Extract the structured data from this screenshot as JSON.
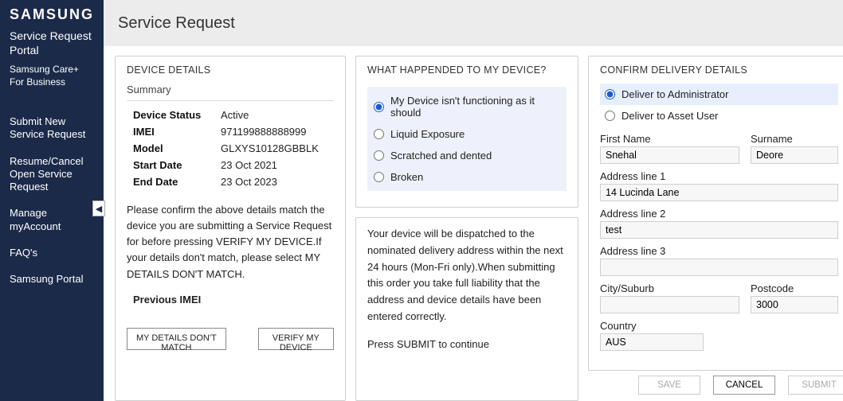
{
  "brand": {
    "name": "SAMSUNG",
    "sub1": "Service Request Portal",
    "sub2": "Samsung Care+ For Business"
  },
  "nav": {
    "items": [
      "Submit New Service Request",
      "Resume/Cancel Open Service Request",
      "Manage myAccount",
      "FAQ's",
      "Samsung Portal"
    ]
  },
  "header": {
    "title": "Service Request"
  },
  "device": {
    "panel_title": "DEVICE DETAILS",
    "summary_label": "Summary",
    "rows": {
      "status_k": "Device Status",
      "status_v": "Active",
      "imei_k": "IMEI",
      "imei_v": "971199888888999",
      "model_k": "Model",
      "model_v": "GLXYS10128GBBLK",
      "start_k": "Start Date",
      "start_v": "23 Oct 2021",
      "end_k": "End Date",
      "end_v": "23 Oct 2023"
    },
    "confirm_text": "Please confirm the above details match the device you are submitting a Service Request for before pressing VERIFY MY DEVICE.If your details don't match, please select MY DETAILS DON'T MATCH.",
    "prev_imei": "Previous IMEI",
    "btn_mismatch": "MY DETAILS DON'T MATCH",
    "btn_verify": "VERIFY MY DEVICE"
  },
  "issue": {
    "panel_title": "WHAT HAPPENDED TO MY DEVICE?",
    "options": [
      "My Device isn't functioning as it should",
      "Liquid Exposure",
      "Scratched and dented",
      "Broken"
    ],
    "selected": 0,
    "dispatch_text": "Your device will be dispatched to the nominated delivery address within the next 24 hours (Mon-Fri only).When submitting this order you take full liability that the address and device details have been entered correctly.",
    "submit_text": "Press SUBMIT to continue"
  },
  "delivery": {
    "panel_title": "CONFIRM DELIVERY DETAILS",
    "opts": [
      "Deliver to Administrator",
      "Deliver to Asset User"
    ],
    "selected": 0,
    "labels": {
      "first_name": "First Name",
      "surname": "Surname",
      "addr1": "Address line 1",
      "addr2": "Address line 2",
      "addr3": "Address line 3",
      "city": "City/Suburb",
      "postcode": "Postcode",
      "country": "Country"
    },
    "values": {
      "first_name": "Snehal",
      "surname": "Deore",
      "addr1": "14 Lucinda Lane",
      "addr2": "test",
      "addr3": "",
      "city": "",
      "postcode": "3000",
      "country": "AUS"
    }
  },
  "footer": {
    "save": "SAVE",
    "cancel": "CANCEL",
    "submit": "SUBMIT"
  }
}
